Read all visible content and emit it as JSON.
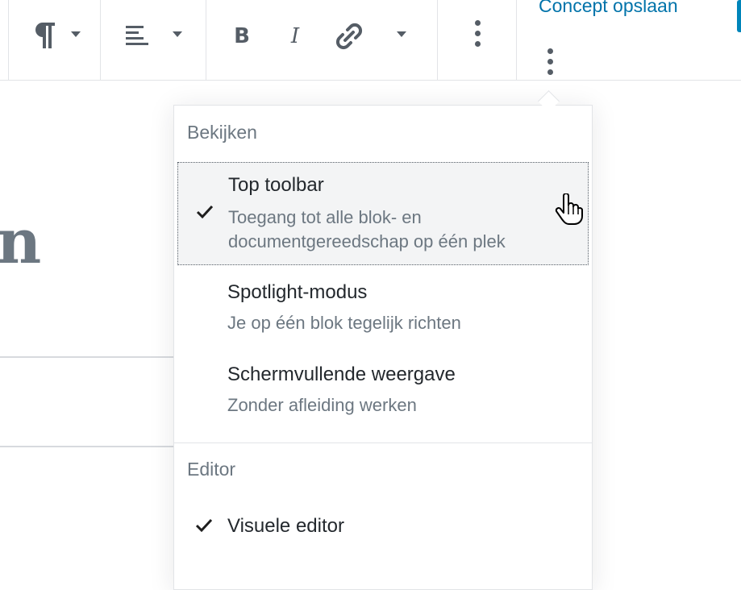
{
  "toolbar": {
    "icons": [
      "paragraph-icon",
      "align-left-icon",
      "bold-icon",
      "italic-icon",
      "link-icon",
      "more-vertical-icon"
    ],
    "save_draft_label": "Concept opslaan"
  },
  "menu": {
    "sections": [
      {
        "title": "Bekijken",
        "items": [
          {
            "label": "Top toolbar",
            "description_lines": [
              "Toegang tot alle blok- en",
              "documentgereedschap op één plek"
            ],
            "checked": true
          },
          {
            "label": "Spotlight-modus",
            "description_lines": [
              "Je op één blok tegelijk richten"
            ],
            "checked": false
          },
          {
            "label": "Schermvullende weergave",
            "description_lines": [
              "Zonder afleiding werken"
            ],
            "checked": false
          }
        ]
      },
      {
        "title": "Editor",
        "items": [
          {
            "label": "Visuele editor",
            "checked": true
          }
        ]
      }
    ]
  },
  "content": {
    "heading_fragment": "n"
  },
  "colors": {
    "accent": "#0073aa",
    "icon": "#555d66",
    "muted_text": "#6c7781",
    "active_bg": "#f3f4f5"
  }
}
